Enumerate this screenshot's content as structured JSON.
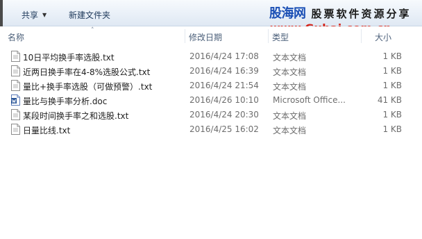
{
  "toolbar": {
    "share_label": "共享",
    "new_folder_label": "新建文件夹"
  },
  "watermark": {
    "brand": "股海网",
    "slogan": "股票软件资源分享",
    "url": "www.Guhai.com.cn"
  },
  "columns": {
    "name": "名称",
    "date": "修改日期",
    "type": "类型",
    "size": "大小"
  },
  "files": [
    {
      "name": "10日平均换手率选股.txt",
      "date": "2016/4/24 17:08",
      "type": "文本文档",
      "size": "1 KB",
      "icon": "text-file-icon"
    },
    {
      "name": "近两日换手率在4-8%选股公式.txt",
      "date": "2016/4/24 16:39",
      "type": "文本文档",
      "size": "1 KB",
      "icon": "text-file-icon"
    },
    {
      "name": "量比+换手率选股（可做预警）.txt",
      "date": "2016/4/24 21:54",
      "type": "文本文档",
      "size": "1 KB",
      "icon": "text-file-icon"
    },
    {
      "name": "量比与换手率分析.doc",
      "date": "2016/4/26 10:10",
      "type": "Microsoft Office...",
      "size": "41 KB",
      "icon": "word-document-icon"
    },
    {
      "name": "某段时间换手率之和选股.txt",
      "date": "2016/4/24 20:30",
      "type": "文本文档",
      "size": "1 KB",
      "icon": "text-file-icon"
    },
    {
      "name": "日量比线.txt",
      "date": "2016/4/25 16:02",
      "type": "文本文档",
      "size": "1 KB",
      "icon": "text-file-icon"
    }
  ]
}
